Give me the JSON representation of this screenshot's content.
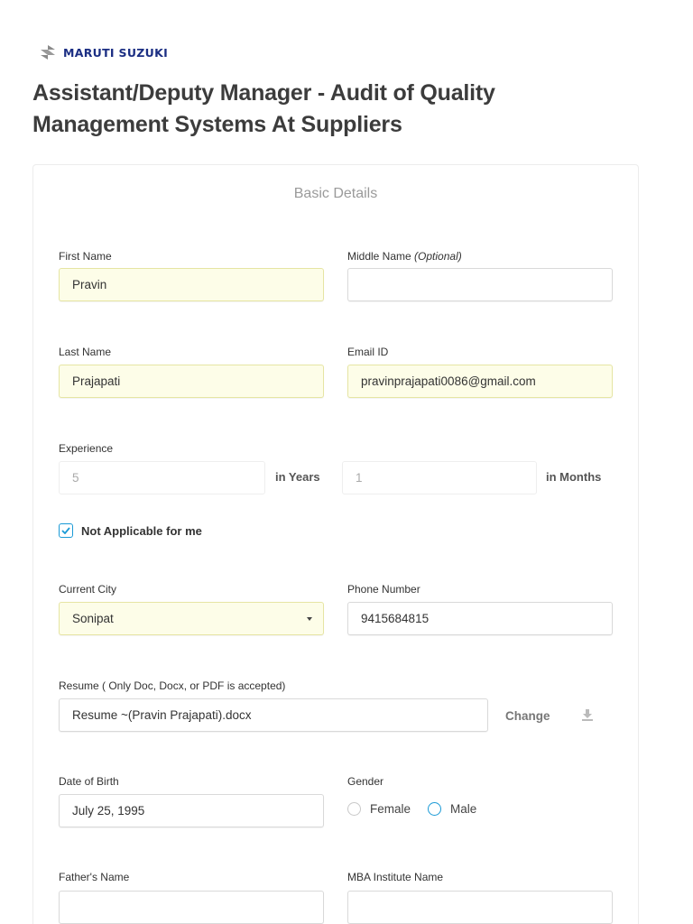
{
  "brand": {
    "logo_text": "MARUTI SUZUKI"
  },
  "page": {
    "title": "Assistant/Deputy Manager - Audit of Quality Management Systems At Suppliers"
  },
  "form": {
    "section_title": "Basic Details",
    "first_name": {
      "label": "First Name",
      "value": "Pravin"
    },
    "middle_name": {
      "label": "Middle Name",
      "optional": "(Optional)",
      "value": ""
    },
    "last_name": {
      "label": "Last Name",
      "value": "Prajapati"
    },
    "email": {
      "label": "Email ID",
      "value": "pravinprajapati0086@gmail.com"
    },
    "experience": {
      "label": "Experience",
      "years_value": "5",
      "years_unit": "in Years",
      "months_value": "1",
      "months_unit": "in Months",
      "not_applicable_label": "Not Applicable for me",
      "not_applicable_checked": true
    },
    "city": {
      "label": "Current City",
      "value": "Sonipat"
    },
    "phone": {
      "label": "Phone Number",
      "value": "9415684815"
    },
    "resume": {
      "label": "Resume ( Only Doc, Docx, or PDF is accepted)",
      "file_name": "Resume ~(Pravin Prajapati).docx",
      "change_label": "Change"
    },
    "dob": {
      "label": "Date of Birth",
      "value": "July 25, 1995"
    },
    "gender": {
      "label": "Gender",
      "options": [
        "Female",
        "Male"
      ],
      "selected": "Male"
    },
    "fathers_name": {
      "label": "Father's Name"
    },
    "mba_institute": {
      "label": "MBA Institute Name"
    }
  },
  "colors": {
    "accent": "#1a9ad6",
    "field_highlight": "#fdfde8",
    "brand_blue": "#1b2e83"
  }
}
